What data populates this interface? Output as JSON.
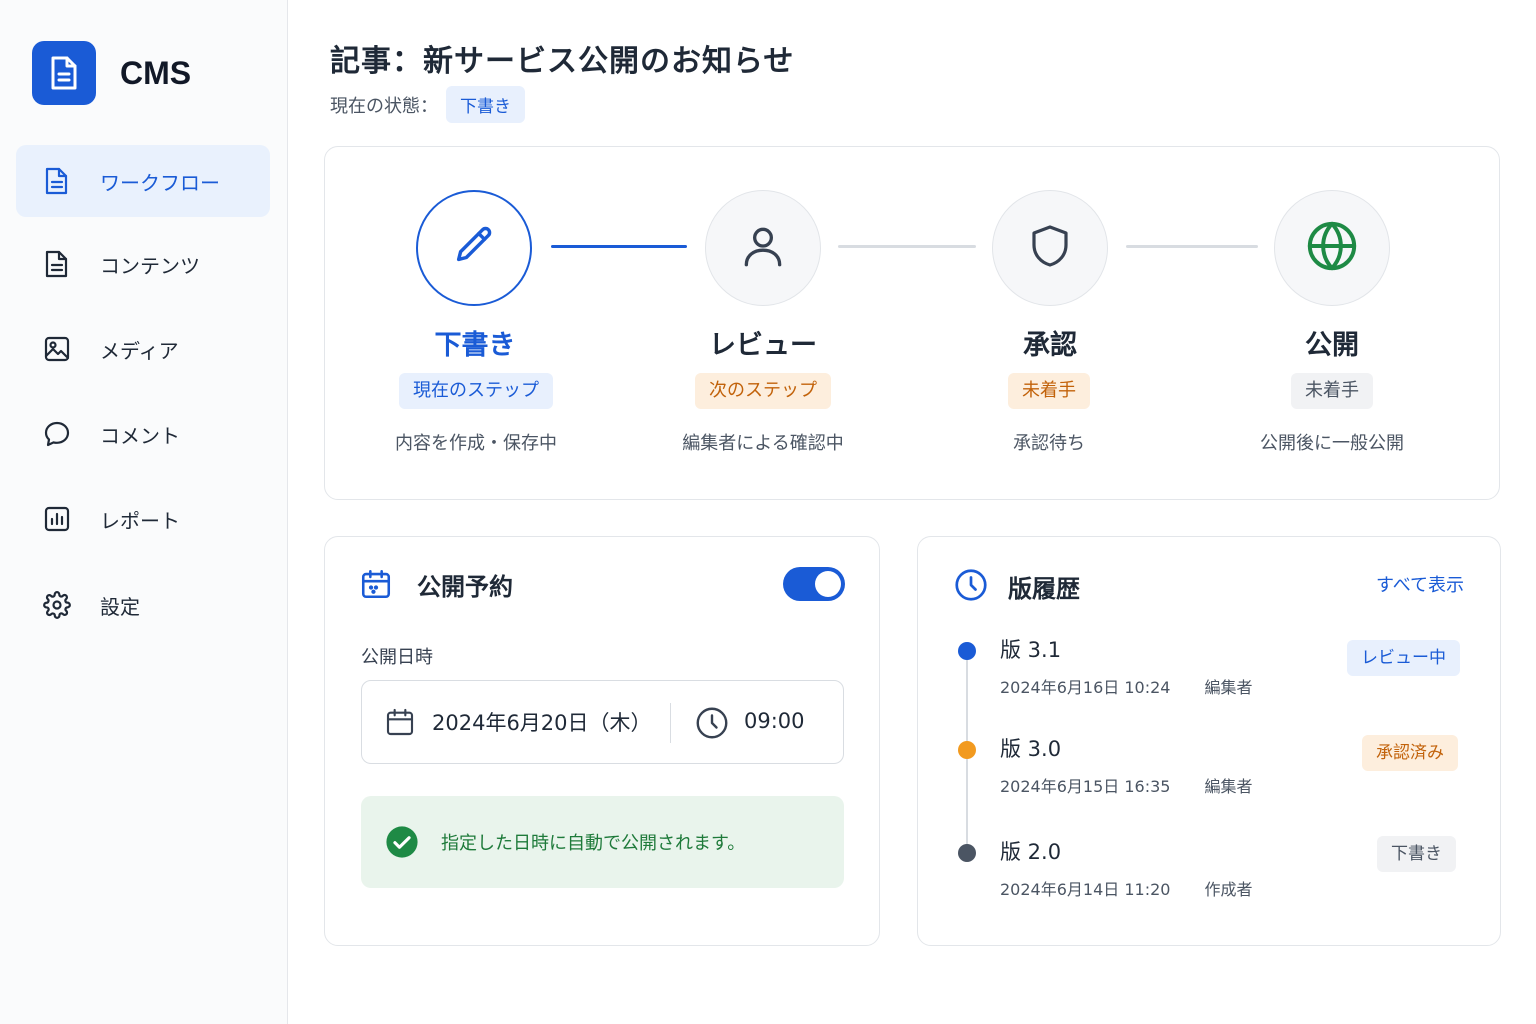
{
  "app": {
    "name": "CMS"
  },
  "sidebar": {
    "items": [
      {
        "label": "ワークフロー",
        "icon": "document-icon"
      },
      {
        "label": "コンテンツ",
        "icon": "document-icon"
      },
      {
        "label": "メディア",
        "icon": "image-icon"
      },
      {
        "label": "コメント",
        "icon": "comment-icon"
      },
      {
        "label": "レポート",
        "icon": "report-icon"
      },
      {
        "label": "設定",
        "icon": "gear-icon"
      }
    ],
    "active": "ワークフロー"
  },
  "header": {
    "title": "記事：新サービス公開のお知らせ",
    "status_label": "現在の状態：",
    "status_value": "下書き"
  },
  "workflow": {
    "steps": [
      {
        "title": "下書き",
        "badge": "現在のステップ",
        "desc": "内容を作成・保存中",
        "icon": "pencil-icon",
        "state": "current"
      },
      {
        "title": "レビュー",
        "badge": "次のステップ",
        "desc": "編集者による確認中",
        "icon": "user-icon",
        "state": "next"
      },
      {
        "title": "承認",
        "badge": "未着手",
        "desc": "承認待ち",
        "icon": "shield-icon",
        "state": "pending"
      },
      {
        "title": "公開",
        "badge": "未着手",
        "desc": "公開後に一般公開",
        "icon": "globe-icon",
        "state": "pending"
      }
    ]
  },
  "schedule": {
    "title": "公開予約",
    "enabled": true,
    "field_label": "公開日時",
    "date": "2024年6月20日（木）",
    "time": "09:00",
    "notice": "指定した日時に自動で公開されます。"
  },
  "history": {
    "title": "版履歴",
    "view_all": "すべて表示",
    "versions": [
      {
        "name": "版 3.1",
        "datetime": "2024年6月16日 10:24",
        "author": "編集者",
        "badge": "レビュー中",
        "dot_color": "#1a5bd6"
      },
      {
        "name": "版 3.0",
        "datetime": "2024年6月15日 16:35",
        "author": "編集者",
        "badge": "承認済み",
        "dot_color": "#f29a1f"
      },
      {
        "name": "版 2.0",
        "datetime": "2024年6月14日 11:20",
        "author": "作成者",
        "badge": "下書き",
        "dot_color": "#4b5563"
      }
    ]
  },
  "colors": {
    "accent": "#1a5bd6",
    "success": "#1e7a3a",
    "warning": "#c2620a"
  }
}
